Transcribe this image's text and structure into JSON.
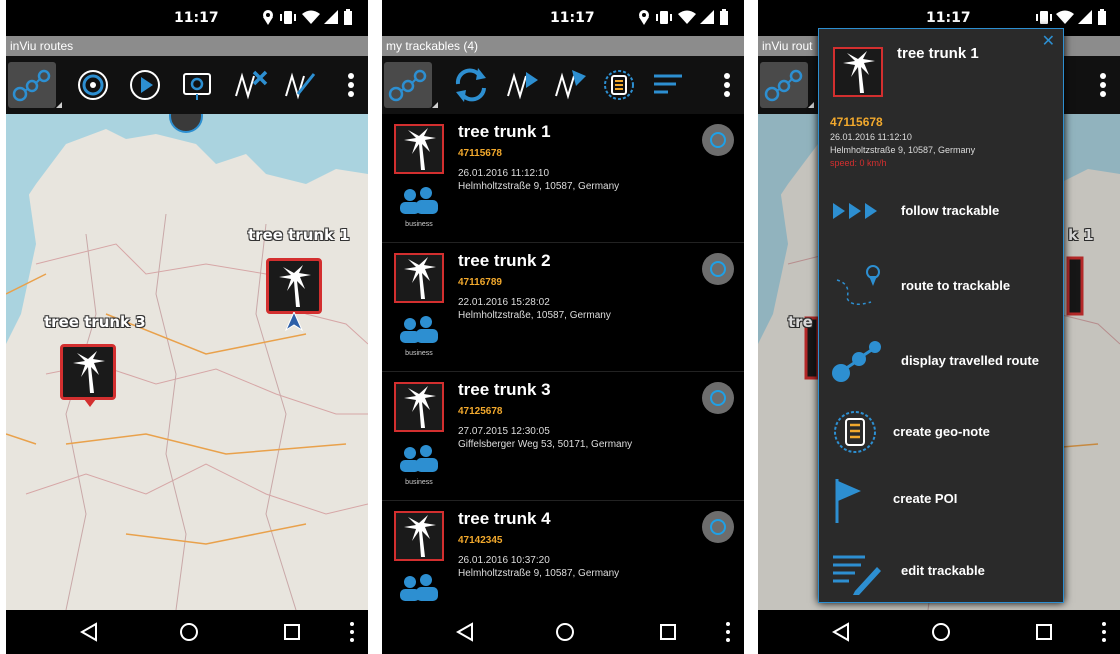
{
  "status": {
    "time": "11:17"
  },
  "screen1": {
    "title": "inViu routes",
    "markers": [
      {
        "label": "tree trunk 1"
      },
      {
        "label": "tree trunk 3"
      }
    ]
  },
  "screen2": {
    "title": "my trackables (4)",
    "items": [
      {
        "name": "tree trunk 1",
        "id": "47115678",
        "date": "26.01.2016 11:12:10",
        "address": "Helmholtzstraße 9,  10587, Germany",
        "group": "business"
      },
      {
        "name": "tree trunk 2",
        "id": "47116789",
        "date": "22.01.2016 15:28:02",
        "address": "Helmholtzstraße,  10587, Germany",
        "group": "business"
      },
      {
        "name": "tree trunk 3",
        "id": "47125678",
        "date": "27.07.2015 12:30:05",
        "address": "Giffelsberger Weg 53,  50171, Germany",
        "group": "business"
      },
      {
        "name": "tree trunk 4",
        "id": "47142345",
        "date": "26.01.2016 10:37:20",
        "address": "Helmholtzstraße 9,  10587, Germany",
        "group": ""
      }
    ]
  },
  "screen3": {
    "title": "inViu rout",
    "popup": {
      "name": "tree trunk 1",
      "id": "47115678",
      "date": "26.01.2016 11:12:10",
      "address": "Helmholtzstraße 9,  10587, Germany",
      "speed": "speed: 0 km/h",
      "actions": [
        {
          "label": "follow trackable",
          "icon": "play-arrows-icon"
        },
        {
          "label": "route to trackable",
          "icon": "route-pin-icon"
        },
        {
          "label": "display travelled route",
          "icon": "route-dots-icon"
        },
        {
          "label": "create geo-note",
          "icon": "geo-note-icon"
        },
        {
          "label": "create POI",
          "icon": "flag-icon"
        },
        {
          "label": "edit trackable",
          "icon": "edit-pencil-icon"
        }
      ]
    },
    "partial_labels": {
      "marker_right": "k 1",
      "marker_left": "tre"
    }
  },
  "colors": {
    "accent": "#2d8fd1",
    "marker_border": "#d32f2f",
    "id_text": "#f2a92d"
  }
}
